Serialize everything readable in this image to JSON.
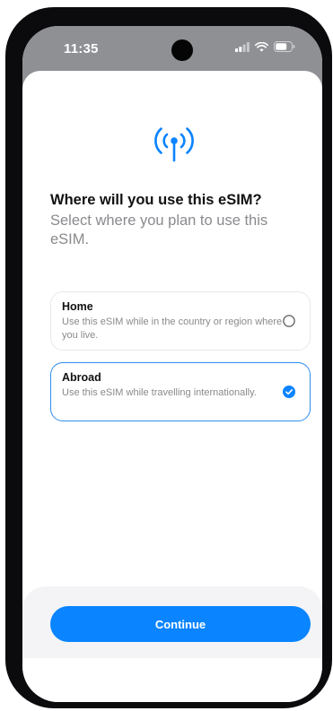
{
  "status_bar": {
    "time": "11:35"
  },
  "icons": {
    "hero": "antenna-signal-icon",
    "cellular": "cellular-signal-icon",
    "wifi": "wifi-icon",
    "battery": "battery-icon"
  },
  "question": {
    "title": "Where will you use this eSIM?",
    "subtitle": "Select where you plan to use this eSIM."
  },
  "options": [
    {
      "title": "Home",
      "description": "Use this eSIM while in the country or region where you live.",
      "selected": false
    },
    {
      "title": "Abroad",
      "description": "Use this eSIM while travelling internationally.",
      "selected": true
    }
  ],
  "continue_label": "Continue",
  "colors": {
    "accent": "#0a84ff",
    "selected_border": "#2c8ef0",
    "secondary_text": "#8a8a8e"
  }
}
